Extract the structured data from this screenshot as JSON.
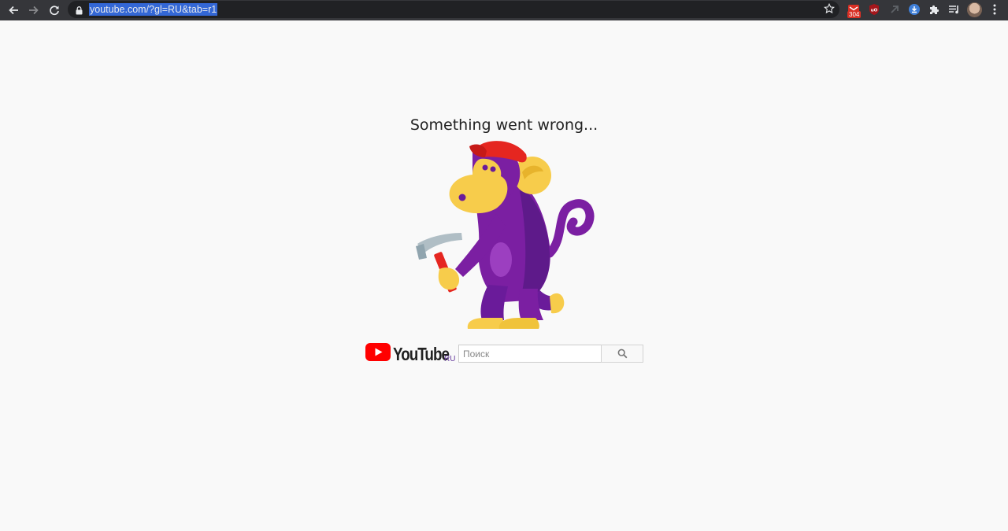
{
  "browser": {
    "url": "youtube.com/?gl=RU&tab=r1",
    "extension_badge": "304",
    "icons": [
      "back-icon",
      "forward-icon",
      "reload-icon",
      "lock-icon",
      "star-icon",
      "extension-mail-icon",
      "ublock-icon",
      "extension-icon",
      "download-icon",
      "puzzle-icon",
      "media-icon",
      "avatar",
      "menu-icon"
    ]
  },
  "page": {
    "error_title": "Something went wrong...",
    "logo_word": "YouTube",
    "logo_region": "RU",
    "search_placeholder": "Поиск",
    "colors": {
      "youtube_red": "#ff0000",
      "monkey_purple": "#7b1fa2",
      "hat_red": "#e52620",
      "face_yellow": "#f7cc4b"
    }
  }
}
